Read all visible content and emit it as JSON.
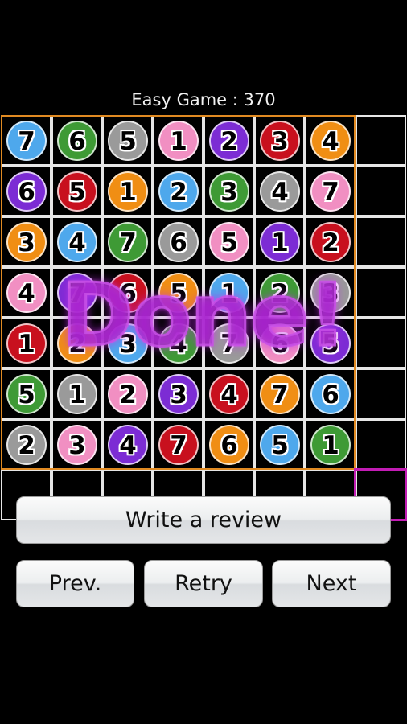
{
  "header": {
    "title": "Easy Game : 370"
  },
  "colors": {
    "blue": "#4ea8ec",
    "green": "#3e9a35",
    "gray": "#9a9a9a",
    "pink": "#f18fc2",
    "purple": "#7c2cd4",
    "red": "#c8101e",
    "orange": "#f08e14",
    "grid_line": "#e6e6e6",
    "solved_frame": "#e08a22",
    "selected_frame": "#c21cb4"
  },
  "board": {
    "columns": 8,
    "rows": 8,
    "selected_cell": {
      "row": 7,
      "col": 7
    },
    "balls": [
      [
        {
          "n": "7",
          "c": "blue"
        },
        {
          "n": "6",
          "c": "green"
        },
        {
          "n": "5",
          "c": "gray"
        },
        {
          "n": "1",
          "c": "pink"
        },
        {
          "n": "2",
          "c": "purple"
        },
        {
          "n": "3",
          "c": "red"
        },
        {
          "n": "4",
          "c": "orange"
        }
      ],
      [
        {
          "n": "6",
          "c": "purple"
        },
        {
          "n": "5",
          "c": "red"
        },
        {
          "n": "1",
          "c": "orange"
        },
        {
          "n": "2",
          "c": "blue"
        },
        {
          "n": "3",
          "c": "green"
        },
        {
          "n": "4",
          "c": "gray"
        },
        {
          "n": "7",
          "c": "pink"
        }
      ],
      [
        {
          "n": "3",
          "c": "orange"
        },
        {
          "n": "4",
          "c": "blue"
        },
        {
          "n": "7",
          "c": "green"
        },
        {
          "n": "6",
          "c": "gray"
        },
        {
          "n": "5",
          "c": "pink"
        },
        {
          "n": "1",
          "c": "purple"
        },
        {
          "n": "2",
          "c": "red"
        }
      ],
      [
        {
          "n": "4",
          "c": "pink"
        },
        {
          "n": "7",
          "c": "purple"
        },
        {
          "n": "6",
          "c": "red"
        },
        {
          "n": "5",
          "c": "orange"
        },
        {
          "n": "1",
          "c": "blue"
        },
        {
          "n": "2",
          "c": "green"
        },
        {
          "n": "3",
          "c": "gray"
        }
      ],
      [
        {
          "n": "1",
          "c": "red"
        },
        {
          "n": "2",
          "c": "orange"
        },
        {
          "n": "3",
          "c": "blue"
        },
        {
          "n": "4",
          "c": "green"
        },
        {
          "n": "7",
          "c": "gray"
        },
        {
          "n": "6",
          "c": "pink"
        },
        {
          "n": "5",
          "c": "purple"
        }
      ],
      [
        {
          "n": "5",
          "c": "green"
        },
        {
          "n": "1",
          "c": "gray"
        },
        {
          "n": "2",
          "c": "pink"
        },
        {
          "n": "3",
          "c": "purple"
        },
        {
          "n": "4",
          "c": "red"
        },
        {
          "n": "7",
          "c": "orange"
        },
        {
          "n": "6",
          "c": "blue"
        }
      ],
      [
        {
          "n": "2",
          "c": "gray"
        },
        {
          "n": "3",
          "c": "pink"
        },
        {
          "n": "4",
          "c": "purple"
        },
        {
          "n": "7",
          "c": "red"
        },
        {
          "n": "6",
          "c": "orange"
        },
        {
          "n": "5",
          "c": "blue"
        },
        {
          "n": "1",
          "c": "green"
        }
      ]
    ]
  },
  "overlay": {
    "done_text": "Done!"
  },
  "buttons": {
    "review": "Write a review",
    "prev": "Prev.",
    "retry": "Retry",
    "next": "Next"
  }
}
